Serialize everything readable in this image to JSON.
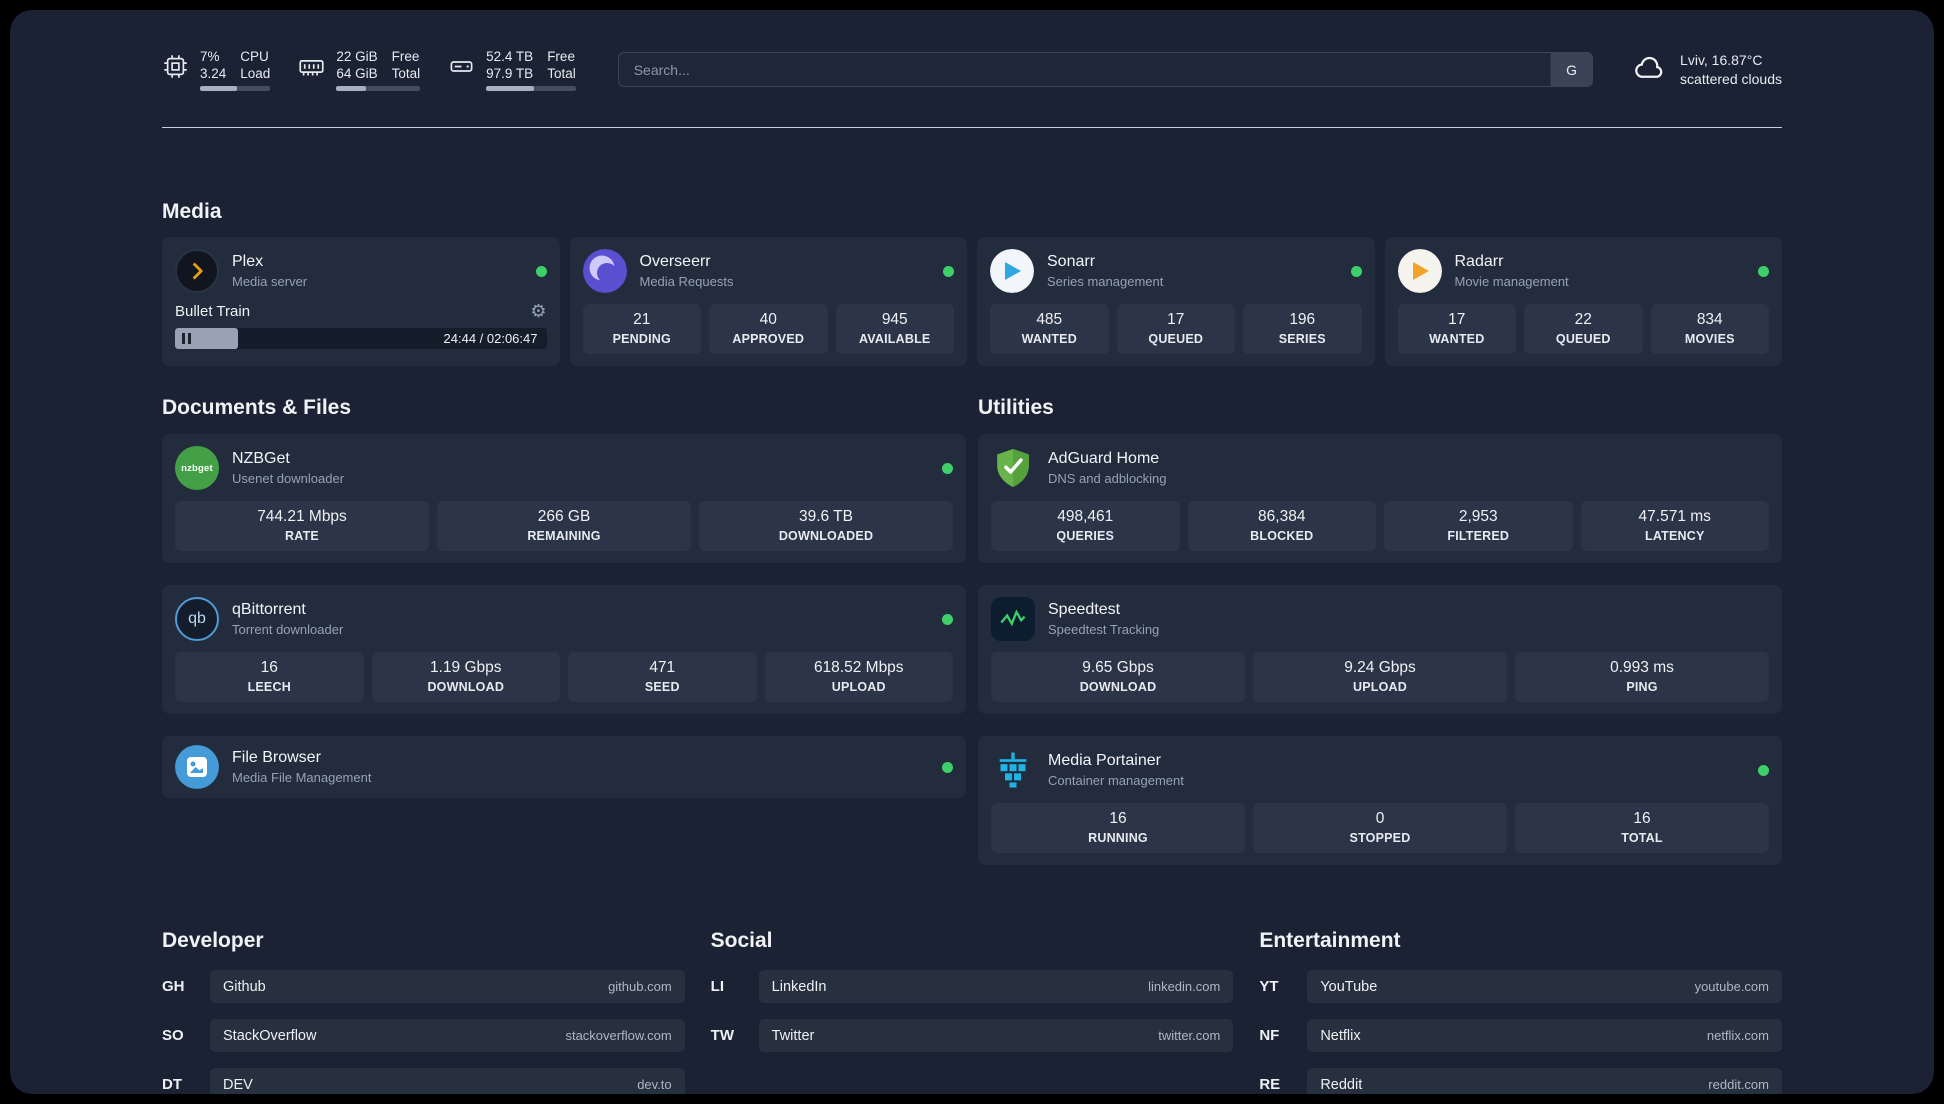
{
  "topbar": {
    "cpu": {
      "percent": "7%",
      "load": "3.24",
      "label_top": "CPU",
      "label_bottom": "Load",
      "bar": "53%"
    },
    "ram": {
      "free": "22 GiB",
      "total": "64 GiB",
      "label_top": "Free",
      "label_bottom": "Total",
      "bar": "35%"
    },
    "disk": {
      "free": "52.4 TB",
      "total": "97.9 TB",
      "label_top": "Free",
      "label_bottom": "Total",
      "bar": "53%"
    },
    "search": {
      "placeholder": "Search...",
      "button_label": "G"
    },
    "weather": {
      "location": "Lviv, 16.87°C",
      "condition": "scattered clouds"
    }
  },
  "sections": {
    "media": "Media",
    "documents": "Documents & Files",
    "utilities": "Utilities",
    "developer": "Developer",
    "social": "Social",
    "entertainment": "Entertainment"
  },
  "apps": {
    "plex": {
      "name": "Plex",
      "subtitle": "Media server",
      "player_title": "Bullet Train",
      "player_time": "24:44 / 02:06:47",
      "progress": "17%"
    },
    "overseerr": {
      "name": "Overseerr",
      "subtitle": "Media Requests",
      "stats": [
        {
          "value": "21",
          "label": "PENDING"
        },
        {
          "value": "40",
          "label": "APPROVED"
        },
        {
          "value": "945",
          "label": "AVAILABLE"
        }
      ]
    },
    "sonarr": {
      "name": "Sonarr",
      "subtitle": "Series management",
      "stats": [
        {
          "value": "485",
          "label": "WANTED"
        },
        {
          "value": "17",
          "label": "QUEUED"
        },
        {
          "value": "196",
          "label": "SERIES"
        }
      ]
    },
    "radarr": {
      "name": "Radarr",
      "subtitle": "Movie management",
      "stats": [
        {
          "value": "17",
          "label": "WANTED"
        },
        {
          "value": "22",
          "label": "QUEUED"
        },
        {
          "value": "834",
          "label": "MOVIES"
        }
      ]
    },
    "nzbget": {
      "name": "NZBGet",
      "subtitle": "Usenet downloader",
      "stats": [
        {
          "value": "744.21 Mbps",
          "label": "RATE"
        },
        {
          "value": "266 GB",
          "label": "REMAINING"
        },
        {
          "value": "39.6 TB",
          "label": "DOWNLOADED"
        }
      ]
    },
    "qbittorrent": {
      "name": "qBittorrent",
      "subtitle": "Torrent downloader",
      "stats": [
        {
          "value": "16",
          "label": "LEECH"
        },
        {
          "value": "1.19 Gbps",
          "label": "DOWNLOAD"
        },
        {
          "value": "471",
          "label": "SEED"
        },
        {
          "value": "618.52 Mbps",
          "label": "UPLOAD"
        }
      ]
    },
    "filebrowser": {
      "name": "File Browser",
      "subtitle": "Media File Management"
    },
    "adguard": {
      "name": "AdGuard Home",
      "subtitle": "DNS and adblocking",
      "stats": [
        {
          "value": "498,461",
          "label": "QUERIES"
        },
        {
          "value": "86,384",
          "label": "BLOCKED"
        },
        {
          "value": "2,953",
          "label": "FILTERED"
        },
        {
          "value": "47.571 ms",
          "label": "LATENCY"
        }
      ]
    },
    "speedtest": {
      "name": "Speedtest",
      "subtitle": "Speedtest Tracking",
      "stats": [
        {
          "value": "9.65 Gbps",
          "label": "DOWNLOAD"
        },
        {
          "value": "9.24 Gbps",
          "label": "UPLOAD"
        },
        {
          "value": "0.993 ms",
          "label": "PING"
        }
      ]
    },
    "portainer": {
      "name": "Media Portainer",
      "subtitle": "Container management",
      "stats": [
        {
          "value": "16",
          "label": "RUNNING"
        },
        {
          "value": "0",
          "label": "STOPPED"
        },
        {
          "value": "16",
          "label": "TOTAL"
        }
      ]
    }
  },
  "links": {
    "developer": [
      {
        "tag": "GH",
        "name": "Github",
        "url": "github.com"
      },
      {
        "tag": "SO",
        "name": "StackOverflow",
        "url": "stackoverflow.com"
      },
      {
        "tag": "DT",
        "name": "DEV",
        "url": "dev.to"
      }
    ],
    "social": [
      {
        "tag": "LI",
        "name": "LinkedIn",
        "url": "linkedin.com"
      },
      {
        "tag": "TW",
        "name": "Twitter",
        "url": "twitter.com"
      }
    ],
    "entertainment": [
      {
        "tag": "YT",
        "name": "YouTube",
        "url": "youtube.com"
      },
      {
        "tag": "NF",
        "name": "Netflix",
        "url": "netflix.com"
      },
      {
        "tag": "RE",
        "name": "Reddit",
        "url": "reddit.com"
      }
    ]
  },
  "colors": {
    "status_online": "#3ecf6a",
    "plex_accent": "#e5a00d",
    "background": "#1a2233",
    "card": "#232c3d"
  }
}
